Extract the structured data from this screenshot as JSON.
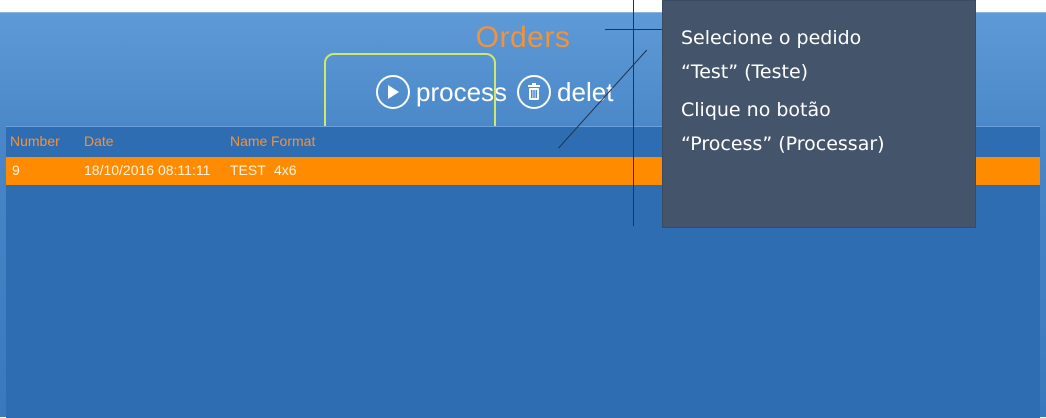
{
  "screen": {
    "title": "Orders"
  },
  "toolbar": {
    "process_label": "process",
    "delete_label": "delet",
    "process_icon": "play-icon",
    "delete_icon": "trash-icon"
  },
  "orders_list": {
    "headers": [
      "Number",
      "Date",
      "Name",
      "Format"
    ],
    "rows": [
      {
        "number": "9",
        "date": "18/10/2016 08:11:11",
        "name": "TEST",
        "format": "4x6"
      }
    ]
  },
  "tooltip": {
    "line1": "Selecione o pedido",
    "line2": "“Test” (Teste)",
    "line3": "Clique no botão",
    "line4": "“Process” (Processar)"
  },
  "colors": {
    "accent_orange": "#f2923a",
    "selected_row": "#ff8c00",
    "panel_blue": "#2f6db3",
    "highlight": "#cde86a",
    "tooltip_bg": "#44546a"
  }
}
